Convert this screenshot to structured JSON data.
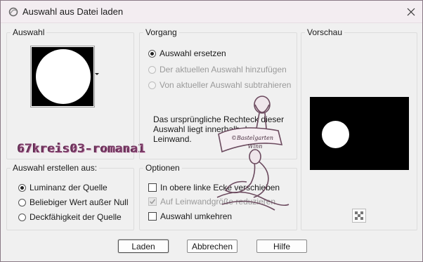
{
  "window": {
    "title": "Auswahl aus Datei laden"
  },
  "auswahl": {
    "label": "Auswahl"
  },
  "vorgang": {
    "label": "Vorgang",
    "options": [
      {
        "label": "Auswahl ersetzen",
        "checked": true,
        "disabled": false
      },
      {
        "label": "Der aktuellen Auswahl hinzufügen",
        "checked": false,
        "disabled": true
      },
      {
        "label": "Von aktueller Auswahl subtrahieren",
        "checked": false,
        "disabled": true
      }
    ],
    "info": "Das ursprüngliche Rechteck dieser Auswahl liegt innerhalb der Leinwand."
  },
  "vorschau": {
    "label": "Vorschau"
  },
  "erstellen": {
    "label": "Auswahl erstellen aus:",
    "options": [
      {
        "label": "Luminanz der Quelle",
        "checked": true
      },
      {
        "label": "Beliebiger Wert außer Null",
        "checked": false
      },
      {
        "label": "Deckfähigkeit der Quelle",
        "checked": false
      }
    ]
  },
  "optionen": {
    "label": "Optionen",
    "items": [
      {
        "label": "In obere linke Ecke verschieben",
        "checked": false,
        "disabled": false
      },
      {
        "label": "Auf Leinwandgröße reduzieren",
        "checked": true,
        "disabled": true
      },
      {
        "label": "Auswahl umkehren",
        "checked": false,
        "disabled": false
      }
    ]
  },
  "buttons": {
    "load": "Laden",
    "cancel": "Abbrechen",
    "help": "Hilfe"
  },
  "watermark": {
    "name": "67kreis03-romana1",
    "logo_text": [
      "©Bastelgarten",
      "Winn"
    ]
  },
  "colors": {
    "accent_pink": "#7a3a66",
    "titlebar": "#f3edf1"
  }
}
